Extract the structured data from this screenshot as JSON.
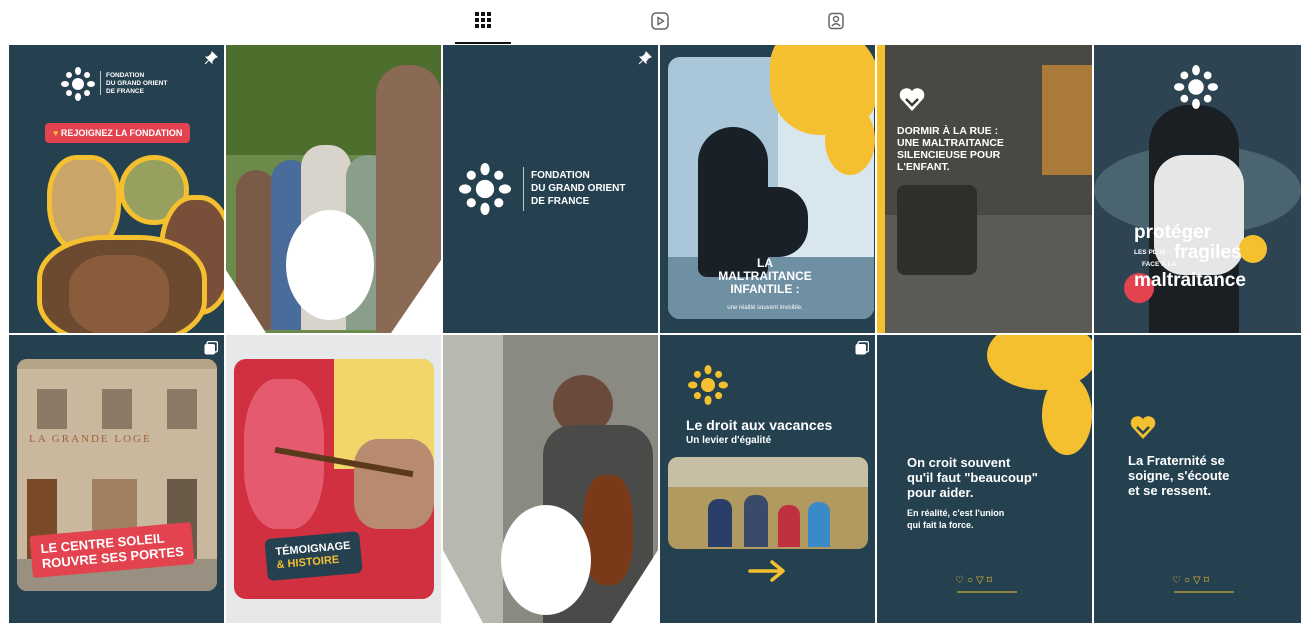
{
  "tabs": [
    {
      "name": "grid-icon"
    },
    {
      "name": "reels-icon"
    },
    {
      "name": "tagged-icon"
    }
  ],
  "colors": {
    "navy": "#254150",
    "yellow": "#f4c02f",
    "red": "#e2434f",
    "white": "#ffffff"
  },
  "posts": {
    "p1": {
      "org1": "FONDATION",
      "org2": "DU GRAND ORIENT",
      "org3": "DE FRANCE",
      "cta": "REJOIGNEZ LA FONDATION"
    },
    "p3": {
      "org1": "FONDATION",
      "org2": "DU GRAND ORIENT",
      "org3": "DE FRANCE"
    },
    "p4": {
      "title1": "LA",
      "title2": "MALTRAITANCE",
      "title3": "INFANTILE :",
      "subtitle": "une réalité souvent invisible."
    },
    "p5": {
      "line1": "DORMIR À LA RUE :",
      "line2": "UNE MALTRAITANCE",
      "line3": "SILENCIEUSE POUR",
      "line4": "L'ENFANT."
    },
    "p6": {
      "w1": "protéger",
      "w2a": "LES PLUS",
      "w2b": "fragiles",
      "w3": "FACE À LA",
      "w4": "maltraitance"
    },
    "p7": {
      "sign": "LA GRANDE LOGE",
      "line1": "LE CENTRE SOLEIL",
      "line2": "ROUVRE SES PORTES"
    },
    "p8": {
      "line1": "TÉMOIGNAGE",
      "line2": "& HISTOIRE"
    },
    "p10": {
      "title": "Le droit aux vacances",
      "subtitle": "Un levier d'égalité"
    },
    "p11": {
      "l1": "On croit souvent",
      "l2": "qu'il faut \"beaucoup\"",
      "l3": "pour aider.",
      "l4": "En réalité, c'est l'union",
      "l5": "qui fait la force."
    },
    "p12": {
      "l1": "La Fraternité se",
      "l2": "soigne, s'écoute",
      "l3": "et se ressent."
    }
  }
}
